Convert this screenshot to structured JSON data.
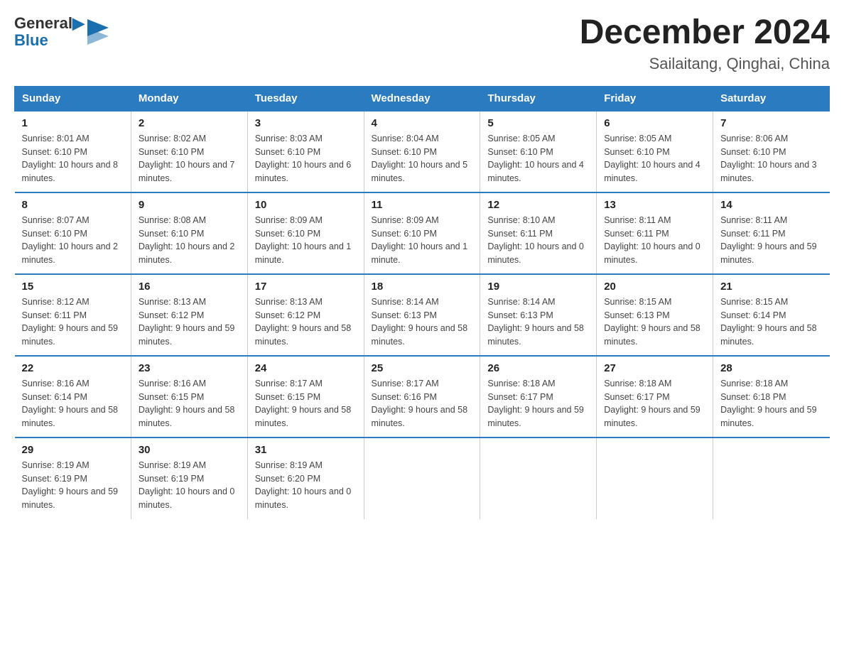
{
  "header": {
    "logo_general": "General",
    "logo_blue": "Blue",
    "month_title": "December 2024",
    "location": "Sailaitang, Qinghai, China"
  },
  "days_of_week": [
    "Sunday",
    "Monday",
    "Tuesday",
    "Wednesday",
    "Thursday",
    "Friday",
    "Saturday"
  ],
  "weeks": [
    [
      {
        "day": "1",
        "sunrise": "8:01 AM",
        "sunset": "6:10 PM",
        "daylight": "10 hours and 8 minutes."
      },
      {
        "day": "2",
        "sunrise": "8:02 AM",
        "sunset": "6:10 PM",
        "daylight": "10 hours and 7 minutes."
      },
      {
        "day": "3",
        "sunrise": "8:03 AM",
        "sunset": "6:10 PM",
        "daylight": "10 hours and 6 minutes."
      },
      {
        "day": "4",
        "sunrise": "8:04 AM",
        "sunset": "6:10 PM",
        "daylight": "10 hours and 5 minutes."
      },
      {
        "day": "5",
        "sunrise": "8:05 AM",
        "sunset": "6:10 PM",
        "daylight": "10 hours and 4 minutes."
      },
      {
        "day": "6",
        "sunrise": "8:05 AM",
        "sunset": "6:10 PM",
        "daylight": "10 hours and 4 minutes."
      },
      {
        "day": "7",
        "sunrise": "8:06 AM",
        "sunset": "6:10 PM",
        "daylight": "10 hours and 3 minutes."
      }
    ],
    [
      {
        "day": "8",
        "sunrise": "8:07 AM",
        "sunset": "6:10 PM",
        "daylight": "10 hours and 2 minutes."
      },
      {
        "day": "9",
        "sunrise": "8:08 AM",
        "sunset": "6:10 PM",
        "daylight": "10 hours and 2 minutes."
      },
      {
        "day": "10",
        "sunrise": "8:09 AM",
        "sunset": "6:10 PM",
        "daylight": "10 hours and 1 minute."
      },
      {
        "day": "11",
        "sunrise": "8:09 AM",
        "sunset": "6:10 PM",
        "daylight": "10 hours and 1 minute."
      },
      {
        "day": "12",
        "sunrise": "8:10 AM",
        "sunset": "6:11 PM",
        "daylight": "10 hours and 0 minutes."
      },
      {
        "day": "13",
        "sunrise": "8:11 AM",
        "sunset": "6:11 PM",
        "daylight": "10 hours and 0 minutes."
      },
      {
        "day": "14",
        "sunrise": "8:11 AM",
        "sunset": "6:11 PM",
        "daylight": "9 hours and 59 minutes."
      }
    ],
    [
      {
        "day": "15",
        "sunrise": "8:12 AM",
        "sunset": "6:11 PM",
        "daylight": "9 hours and 59 minutes."
      },
      {
        "day": "16",
        "sunrise": "8:13 AM",
        "sunset": "6:12 PM",
        "daylight": "9 hours and 59 minutes."
      },
      {
        "day": "17",
        "sunrise": "8:13 AM",
        "sunset": "6:12 PM",
        "daylight": "9 hours and 58 minutes."
      },
      {
        "day": "18",
        "sunrise": "8:14 AM",
        "sunset": "6:13 PM",
        "daylight": "9 hours and 58 minutes."
      },
      {
        "day": "19",
        "sunrise": "8:14 AM",
        "sunset": "6:13 PM",
        "daylight": "9 hours and 58 minutes."
      },
      {
        "day": "20",
        "sunrise": "8:15 AM",
        "sunset": "6:13 PM",
        "daylight": "9 hours and 58 minutes."
      },
      {
        "day": "21",
        "sunrise": "8:15 AM",
        "sunset": "6:14 PM",
        "daylight": "9 hours and 58 minutes."
      }
    ],
    [
      {
        "day": "22",
        "sunrise": "8:16 AM",
        "sunset": "6:14 PM",
        "daylight": "9 hours and 58 minutes."
      },
      {
        "day": "23",
        "sunrise": "8:16 AM",
        "sunset": "6:15 PM",
        "daylight": "9 hours and 58 minutes."
      },
      {
        "day": "24",
        "sunrise": "8:17 AM",
        "sunset": "6:15 PM",
        "daylight": "9 hours and 58 minutes."
      },
      {
        "day": "25",
        "sunrise": "8:17 AM",
        "sunset": "6:16 PM",
        "daylight": "9 hours and 58 minutes."
      },
      {
        "day": "26",
        "sunrise": "8:18 AM",
        "sunset": "6:17 PM",
        "daylight": "9 hours and 59 minutes."
      },
      {
        "day": "27",
        "sunrise": "8:18 AM",
        "sunset": "6:17 PM",
        "daylight": "9 hours and 59 minutes."
      },
      {
        "day": "28",
        "sunrise": "8:18 AM",
        "sunset": "6:18 PM",
        "daylight": "9 hours and 59 minutes."
      }
    ],
    [
      {
        "day": "29",
        "sunrise": "8:19 AM",
        "sunset": "6:19 PM",
        "daylight": "9 hours and 59 minutes."
      },
      {
        "day": "30",
        "sunrise": "8:19 AM",
        "sunset": "6:19 PM",
        "daylight": "10 hours and 0 minutes."
      },
      {
        "day": "31",
        "sunrise": "8:19 AM",
        "sunset": "6:20 PM",
        "daylight": "10 hours and 0 minutes."
      },
      null,
      null,
      null,
      null
    ]
  ]
}
